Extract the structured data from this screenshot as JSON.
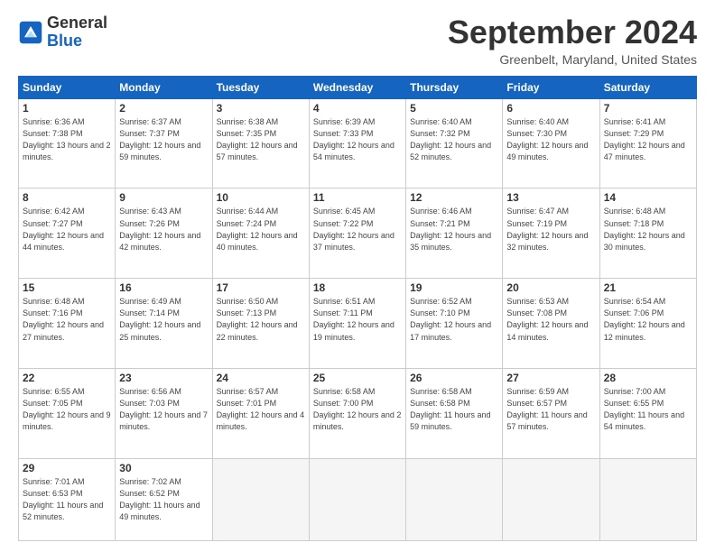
{
  "logo": {
    "line1": "General",
    "line2": "Blue"
  },
  "title": "September 2024",
  "location": "Greenbelt, Maryland, United States",
  "weekdays": [
    "Sunday",
    "Monday",
    "Tuesday",
    "Wednesday",
    "Thursday",
    "Friday",
    "Saturday"
  ],
  "weeks": [
    [
      {
        "day": 1,
        "sunrise": "6:36 AM",
        "sunset": "7:38 PM",
        "daylight": "13 hours and 2 minutes."
      },
      {
        "day": 2,
        "sunrise": "6:37 AM",
        "sunset": "7:37 PM",
        "daylight": "12 hours and 59 minutes."
      },
      {
        "day": 3,
        "sunrise": "6:38 AM",
        "sunset": "7:35 PM",
        "daylight": "12 hours and 57 minutes."
      },
      {
        "day": 4,
        "sunrise": "6:39 AM",
        "sunset": "7:33 PM",
        "daylight": "12 hours and 54 minutes."
      },
      {
        "day": 5,
        "sunrise": "6:40 AM",
        "sunset": "7:32 PM",
        "daylight": "12 hours and 52 minutes."
      },
      {
        "day": 6,
        "sunrise": "6:40 AM",
        "sunset": "7:30 PM",
        "daylight": "12 hours and 49 minutes."
      },
      {
        "day": 7,
        "sunrise": "6:41 AM",
        "sunset": "7:29 PM",
        "daylight": "12 hours and 47 minutes."
      }
    ],
    [
      {
        "day": 8,
        "sunrise": "6:42 AM",
        "sunset": "7:27 PM",
        "daylight": "12 hours and 44 minutes."
      },
      {
        "day": 9,
        "sunrise": "6:43 AM",
        "sunset": "7:26 PM",
        "daylight": "12 hours and 42 minutes."
      },
      {
        "day": 10,
        "sunrise": "6:44 AM",
        "sunset": "7:24 PM",
        "daylight": "12 hours and 40 minutes."
      },
      {
        "day": 11,
        "sunrise": "6:45 AM",
        "sunset": "7:22 PM",
        "daylight": "12 hours and 37 minutes."
      },
      {
        "day": 12,
        "sunrise": "6:46 AM",
        "sunset": "7:21 PM",
        "daylight": "12 hours and 35 minutes."
      },
      {
        "day": 13,
        "sunrise": "6:47 AM",
        "sunset": "7:19 PM",
        "daylight": "12 hours and 32 minutes."
      },
      {
        "day": 14,
        "sunrise": "6:48 AM",
        "sunset": "7:18 PM",
        "daylight": "12 hours and 30 minutes."
      }
    ],
    [
      {
        "day": 15,
        "sunrise": "6:48 AM",
        "sunset": "7:16 PM",
        "daylight": "12 hours and 27 minutes."
      },
      {
        "day": 16,
        "sunrise": "6:49 AM",
        "sunset": "7:14 PM",
        "daylight": "12 hours and 25 minutes."
      },
      {
        "day": 17,
        "sunrise": "6:50 AM",
        "sunset": "7:13 PM",
        "daylight": "12 hours and 22 minutes."
      },
      {
        "day": 18,
        "sunrise": "6:51 AM",
        "sunset": "7:11 PM",
        "daylight": "12 hours and 19 minutes."
      },
      {
        "day": 19,
        "sunrise": "6:52 AM",
        "sunset": "7:10 PM",
        "daylight": "12 hours and 17 minutes."
      },
      {
        "day": 20,
        "sunrise": "6:53 AM",
        "sunset": "7:08 PM",
        "daylight": "12 hours and 14 minutes."
      },
      {
        "day": 21,
        "sunrise": "6:54 AM",
        "sunset": "7:06 PM",
        "daylight": "12 hours and 12 minutes."
      }
    ],
    [
      {
        "day": 22,
        "sunrise": "6:55 AM",
        "sunset": "7:05 PM",
        "daylight": "12 hours and 9 minutes."
      },
      {
        "day": 23,
        "sunrise": "6:56 AM",
        "sunset": "7:03 PM",
        "daylight": "12 hours and 7 minutes."
      },
      {
        "day": 24,
        "sunrise": "6:57 AM",
        "sunset": "7:01 PM",
        "daylight": "12 hours and 4 minutes."
      },
      {
        "day": 25,
        "sunrise": "6:58 AM",
        "sunset": "7:00 PM",
        "daylight": "12 hours and 2 minutes."
      },
      {
        "day": 26,
        "sunrise": "6:58 AM",
        "sunset": "6:58 PM",
        "daylight": "11 hours and 59 minutes."
      },
      {
        "day": 27,
        "sunrise": "6:59 AM",
        "sunset": "6:57 PM",
        "daylight": "11 hours and 57 minutes."
      },
      {
        "day": 28,
        "sunrise": "7:00 AM",
        "sunset": "6:55 PM",
        "daylight": "11 hours and 54 minutes."
      }
    ],
    [
      {
        "day": 29,
        "sunrise": "7:01 AM",
        "sunset": "6:53 PM",
        "daylight": "11 hours and 52 minutes."
      },
      {
        "day": 30,
        "sunrise": "7:02 AM",
        "sunset": "6:52 PM",
        "daylight": "11 hours and 49 minutes."
      },
      null,
      null,
      null,
      null,
      null
    ]
  ]
}
